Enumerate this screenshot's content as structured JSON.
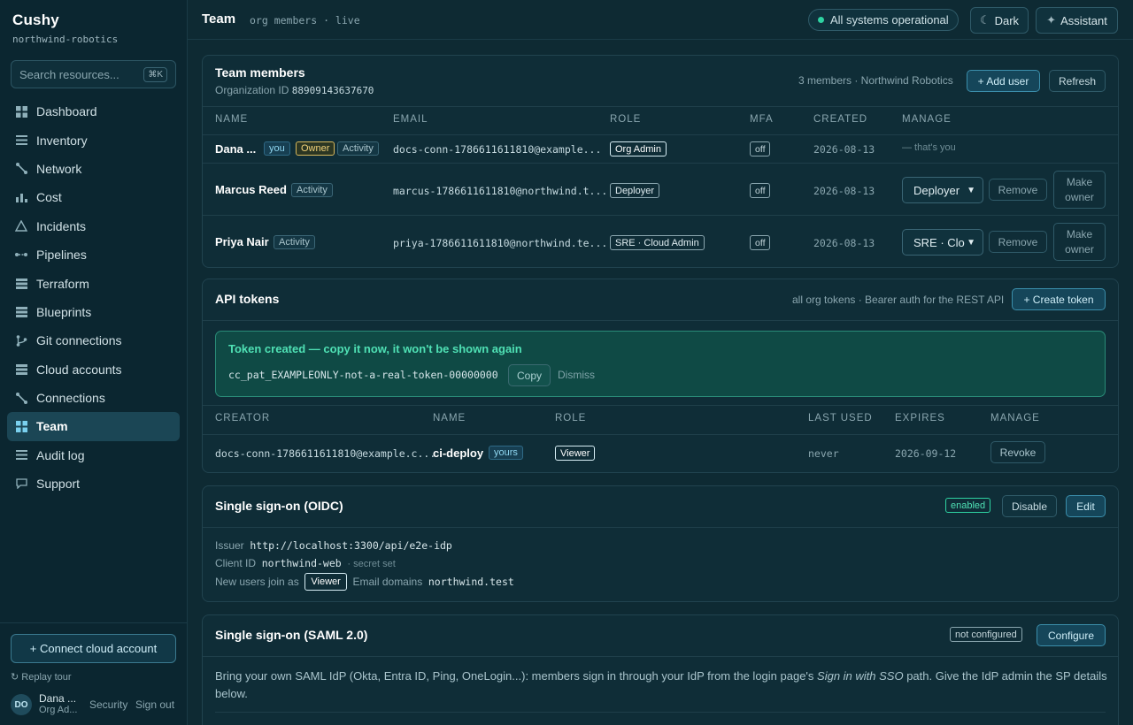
{
  "app": {
    "name": "Cushy",
    "org_slug": "northwind-robotics"
  },
  "search": {
    "placeholder": "Search resources...",
    "shortcut": "⌘K"
  },
  "sidebar": {
    "items": [
      {
        "label": "Dashboard",
        "icon": "grid-icon"
      },
      {
        "label": "Inventory",
        "icon": "list-icon"
      },
      {
        "label": "Network",
        "icon": "network-icon"
      },
      {
        "label": "Cost",
        "icon": "bar-chart-icon"
      },
      {
        "label": "Incidents",
        "icon": "warning-triangle-icon"
      },
      {
        "label": "Pipelines",
        "icon": "pipeline-icon"
      },
      {
        "label": "Terraform",
        "icon": "stack-icon"
      },
      {
        "label": "Blueprints",
        "icon": "stack-icon"
      },
      {
        "label": "Git connections",
        "icon": "git-branch-icon"
      },
      {
        "label": "Cloud accounts",
        "icon": "stack-icon"
      },
      {
        "label": "Connections",
        "icon": "network-icon"
      },
      {
        "label": "Team",
        "icon": "grid-icon",
        "active": true
      },
      {
        "label": "Audit log",
        "icon": "list-icon"
      },
      {
        "label": "Support",
        "icon": "chat-bubble-icon"
      }
    ],
    "connect_label": "+ Connect cloud account",
    "replay_label": "Replay tour",
    "user": {
      "initials": "DO",
      "name": "Dana ...",
      "role": "Org Ad...",
      "security_label": "Security",
      "signout_label": "Sign out"
    }
  },
  "header": {
    "title": "Team",
    "subtitle": "org members · live",
    "status": "All systems operational",
    "status_color": "#2ed3a2",
    "theme_label": "Dark",
    "assistant_label": "Assistant"
  },
  "members": {
    "title": "Team members",
    "org_id_label": "Organization ID",
    "org_id": "88909143637670",
    "summary": "3 members · Northwind Robotics",
    "add_label": "+ Add user",
    "refresh_label": "Refresh",
    "columns": [
      "NAME",
      "EMAIL",
      "ROLE",
      "MFA",
      "CREATED",
      "MANAGE"
    ],
    "rows": [
      {
        "name": "Dana ...",
        "you": "you",
        "owner": "Owner",
        "activity": "Activity",
        "email": "docs-conn-1786611611810@example...",
        "role": "Org Admin",
        "mfa": "off",
        "created": "2026-08-13",
        "manage_note": "— that's you"
      },
      {
        "name": "Marcus Reed",
        "activity": "Activity",
        "email": "marcus-1786611611810@northwind.t...",
        "role": "Deployer",
        "mfa": "off",
        "created": "2026-08-13",
        "select": "Deployer",
        "remove": "Remove",
        "make_owner": "Make owner"
      },
      {
        "name": "Priya Nair",
        "activity": "Activity",
        "email": "priya-1786611611810@northwind.te...",
        "role": "SRE · Cloud Admin",
        "mfa": "off",
        "created": "2026-08-13",
        "select": "SRE · Clo",
        "remove": "Remove",
        "make_owner": "Make owner"
      }
    ]
  },
  "tokens": {
    "title": "API tokens",
    "summary": "all org tokens · Bearer auth for the REST API",
    "create_label": "+ Create token",
    "notice": {
      "title": "Token created — copy it now, it won't be shown again",
      "token": "cc_pat_EXAMPLEONLY-not-a-real-token-00000000",
      "copy_label": "Copy",
      "dismiss_label": "Dismiss"
    },
    "columns": [
      "CREATOR",
      "NAME",
      "ROLE",
      "LAST USED",
      "EXPIRES",
      "MANAGE"
    ],
    "rows": [
      {
        "creator": "docs-conn-1786611611810@example.c...",
        "name": "ci-deploy",
        "tag": "yours",
        "role": "Viewer",
        "last_used": "never",
        "expires": "2026-09-12",
        "revoke": "Revoke"
      }
    ]
  },
  "oidc": {
    "title": "Single sign-on (OIDC)",
    "status": "enabled",
    "disable_label": "Disable",
    "edit_label": "Edit",
    "issuer_label": "Issuer",
    "issuer": "http://localhost:3300/api/e2e-idp",
    "client_label": "Client ID",
    "client_id": "northwind-web",
    "secret_note": "· secret set",
    "join_label": "New users join as",
    "join_role": "Viewer",
    "domains_label": "Email domains",
    "domains": "northwind.test"
  },
  "saml": {
    "title": "Single sign-on (SAML 2.0)",
    "status": "not configured",
    "configure_label": "Configure",
    "desc_pre": "Bring your own SAML IdP (Okta, Entra ID, Ping, OneLogin...): members sign in through your IdP from the login page's ",
    "desc_em": "Sign in with SSO",
    "desc_post": " path. Give the IdP admin the SP details below."
  }
}
